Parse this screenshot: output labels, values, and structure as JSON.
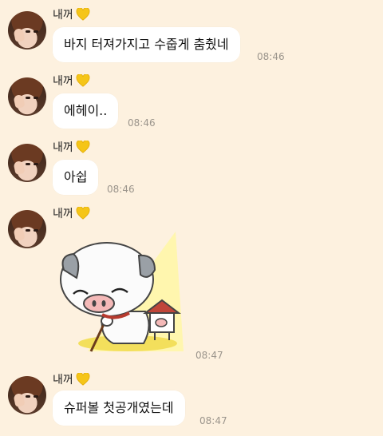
{
  "messages": [
    {
      "sender": "내꺼",
      "heart_icon": "yellow-heart-icon",
      "text": "바지 터져가지고 수줍게 춤췄네",
      "time": "08:46"
    },
    {
      "sender": "내꺼",
      "heart_icon": "yellow-heart-icon",
      "text": "에헤이..",
      "time": "08:46"
    },
    {
      "sender": "내꺼",
      "heart_icon": "yellow-heart-icon",
      "text": "아쉽",
      "time": "08:46"
    },
    {
      "sender": "내꺼",
      "heart_icon": "yellow-heart-icon",
      "sticker": "shy-pig-sticker",
      "time": "08:47"
    },
    {
      "sender": "내꺼",
      "heart_icon": "yellow-heart-icon",
      "text": "슈퍼볼 첫공개였는데",
      "time": "08:47"
    }
  ],
  "colors": {
    "background": "#fdf1df",
    "bubble": "#ffffff",
    "heart": "#f5c518",
    "timestamp": "#9b958c"
  }
}
